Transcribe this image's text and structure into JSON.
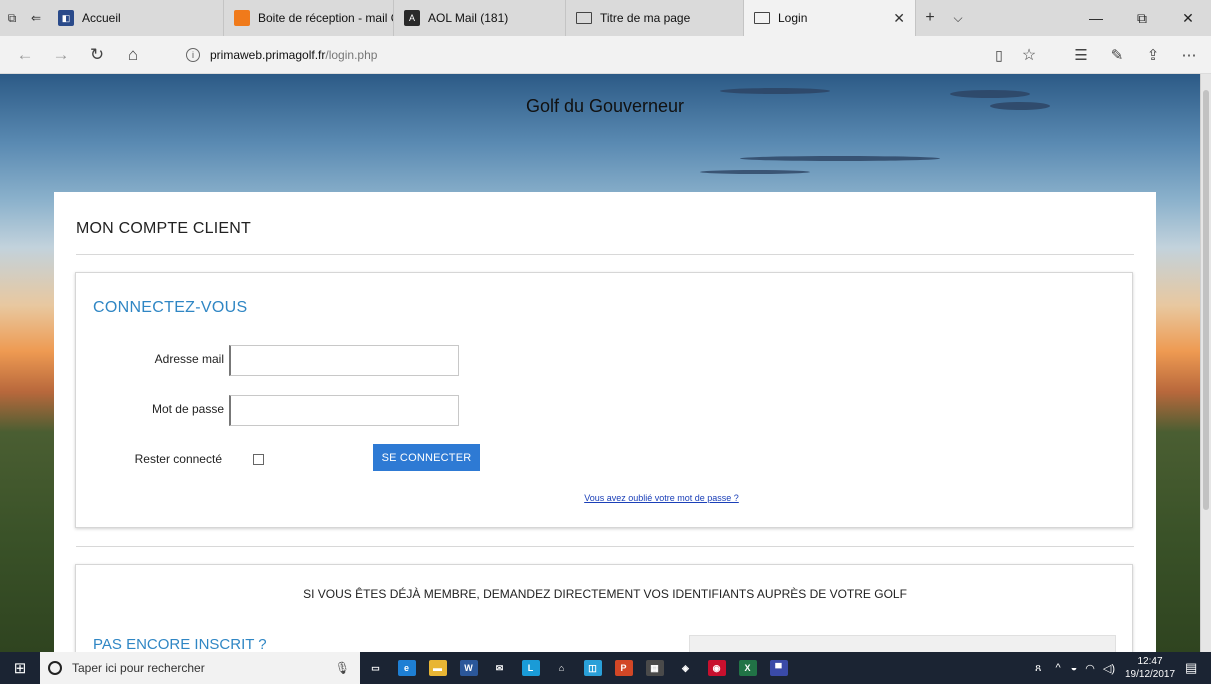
{
  "browser": {
    "tabs": [
      {
        "label": "Accueil",
        "color": "#2a4a8a",
        "glyph": "◧"
      },
      {
        "label": "Boite de réception - mail Oı",
        "color": "#f07a1a",
        "glyph": "▬"
      },
      {
        "label": "AOL Mail (181)",
        "color": "#2a2a2a",
        "glyph": "A"
      },
      {
        "label": "Titre de ma page",
        "color": "#ffffff",
        "glyph": "▭"
      },
      {
        "label": "Login",
        "color": "#ffffff",
        "glyph": "▭"
      }
    ],
    "url_domain": "primaweb.primagolf.fr",
    "url_path": "/login.php"
  },
  "site": {
    "title": "Golf du Gouverneur"
  },
  "account": {
    "title": "MON COMPTE CLIENT"
  },
  "login": {
    "heading": "CONNECTEZ-VOUS",
    "email_label": "Adresse mail",
    "email_value": "",
    "password_label": "Mot de passe",
    "password_value": "",
    "remember_label": "Rester connecté",
    "remember_checked": false,
    "submit_label": "SE CONNECTER",
    "forgot_label": "Vous avez oublié votre mot de passe ?"
  },
  "register": {
    "notice": "SI VOUS ÊTES DÉJÀ MEMBRE, DEMANDEZ DIRECTEMENT VOS IDENTIFIANTS AUPRÈS DE VOTRE GOLF",
    "heading": "PAS ENCORE INSCRIT ?"
  },
  "taskbar": {
    "search_placeholder": "Taper ici pour rechercher",
    "apps": [
      {
        "name": "task-view-icon",
        "color": "#1b2433",
        "glyph": "▭"
      },
      {
        "name": "edge-icon",
        "color": "#1e7fd4",
        "glyph": "e"
      },
      {
        "name": "file-explorer-icon",
        "color": "#e8b534",
        "glyph": "▬"
      },
      {
        "name": "word-icon",
        "color": "#2b579a",
        "glyph": "W"
      },
      {
        "name": "mail-icon",
        "color": "#1b2433",
        "glyph": "✉"
      },
      {
        "name": "app-l-icon",
        "color": "#1a9bd7",
        "glyph": "L"
      },
      {
        "name": "store-icon",
        "color": "#1b2433",
        "glyph": "⌂"
      },
      {
        "name": "app-blue-icon",
        "color": "#2aa0d8",
        "glyph": "◫"
      },
      {
        "name": "powerpoint-icon",
        "color": "#d24726",
        "glyph": "P"
      },
      {
        "name": "calculator-icon",
        "color": "#4a4a4a",
        "glyph": "▦"
      },
      {
        "name": "app-white-icon",
        "color": "#1b2433",
        "glyph": "◈"
      },
      {
        "name": "app-red-icon",
        "color": "#c8102e",
        "glyph": "◉"
      },
      {
        "name": "excel-icon",
        "color": "#217346",
        "glyph": "X"
      },
      {
        "name": "app-purple-icon",
        "color": "#3a4aa8",
        "glyph": "▀"
      }
    ],
    "clock_time": "12:47",
    "clock_date": "19/12/2017"
  }
}
